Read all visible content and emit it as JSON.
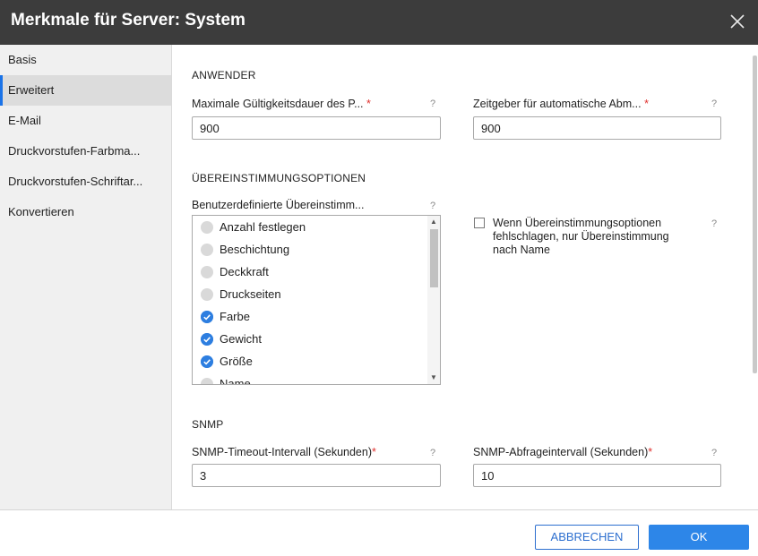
{
  "window": {
    "title": "Merkmale für Server: System"
  },
  "sidebar": {
    "items": [
      {
        "label": "Basis"
      },
      {
        "label": "Erweitert"
      },
      {
        "label": "E-Mail"
      },
      {
        "label": "Druckvorstufen-Farbma..."
      },
      {
        "label": "Druckvorstufen-Schriftar..."
      },
      {
        "label": "Konvertieren"
      }
    ],
    "active_index": 1
  },
  "anwender": {
    "section_title": "ANWENDER",
    "max_duration": {
      "label": "Maximale Gültigkeitsdauer des P...",
      "required": "*",
      "help": "?",
      "value": "900"
    },
    "auto_logout": {
      "label": "Zeitgeber für automatische Abm...",
      "required": "*",
      "help": "?",
      "value": "900"
    }
  },
  "matching": {
    "section_title": "ÜBEREINSTIMMUNGSOPTIONEN",
    "custom": {
      "label": "Benutzerdefinierte Übereinstimm...",
      "help": "?"
    },
    "options": [
      {
        "label": "Anzahl festlegen",
        "checked": false
      },
      {
        "label": "Beschichtung",
        "checked": false
      },
      {
        "label": "Deckkraft",
        "checked": false
      },
      {
        "label": "Druckseiten",
        "checked": false
      },
      {
        "label": "Farbe",
        "checked": true
      },
      {
        "label": "Gewicht",
        "checked": true
      },
      {
        "label": "Größe",
        "checked": true
      },
      {
        "label": "Name",
        "checked": false
      }
    ],
    "fallback": {
      "label": "Wenn Übereinstimmungsoptionen fehlschlagen, nur Übereinstimmung nach Name",
      "checked": false,
      "help": "?"
    }
  },
  "snmp": {
    "section_title": "SNMP",
    "timeout": {
      "label": "SNMP-Timeout-Intervall (Sekunden)",
      "required": "*",
      "help": "?",
      "value": "3"
    },
    "poll": {
      "label": "SNMP-Abfrageintervall (Sekunden)",
      "required": "*",
      "help": "?",
      "value": "10"
    }
  },
  "footer": {
    "cancel_label": "ABBRECHEN",
    "ok_label": "OK"
  },
  "colors": {
    "titlebar": "#3c3c3c",
    "accent": "#2d86e8",
    "check": "#2d7ee0",
    "required": "#e0312e"
  }
}
